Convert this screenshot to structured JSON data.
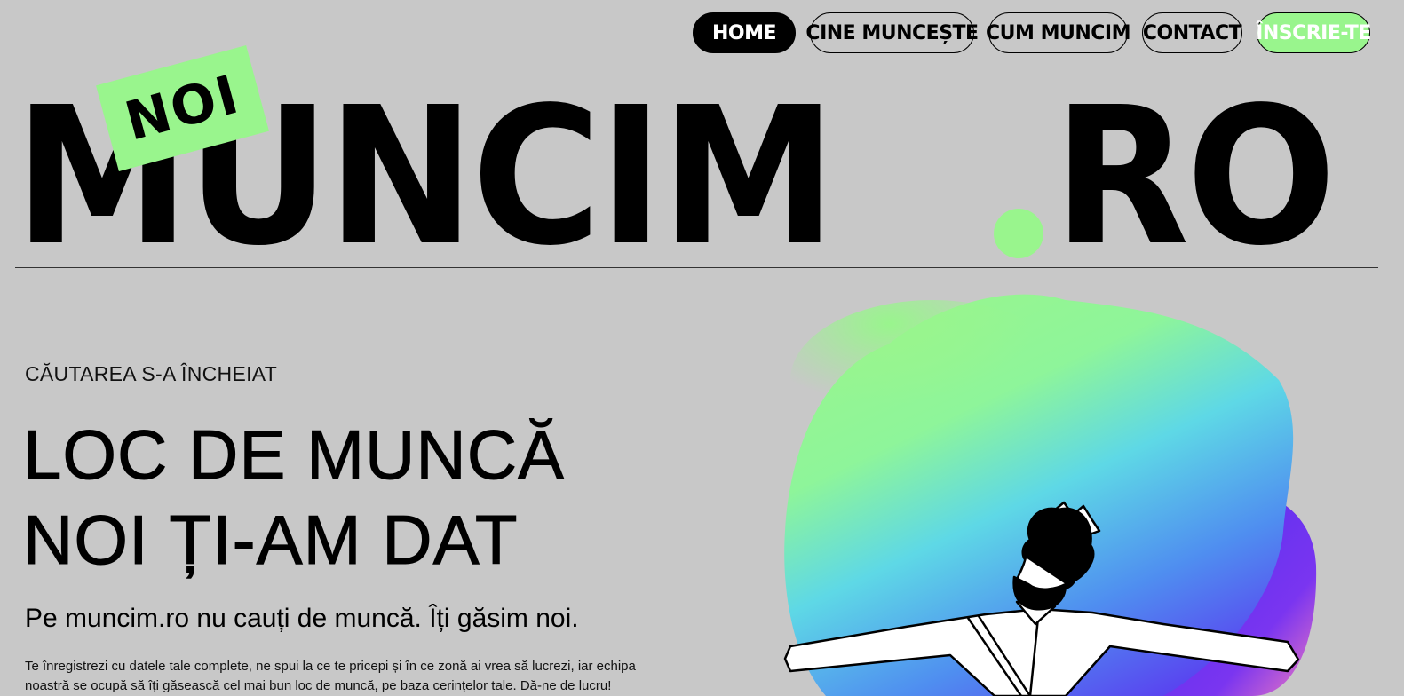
{
  "nav": {
    "items": [
      {
        "label": "HOME"
      },
      {
        "label": "CINE MUNCEȘTE"
      },
      {
        "label": "CUM MUNCIM"
      },
      {
        "label": "CONTACT"
      },
      {
        "label": "ÎNSCRIE-TE"
      }
    ]
  },
  "logo": {
    "badge": "NOI",
    "word": "MUNCIM",
    "suffix": "RO"
  },
  "hero": {
    "eyebrow": "CĂUTAREA S-A ÎNCHEIAT",
    "headline_line1": "LOC DE MUNCĂ",
    "headline_line2": "NOI ȚI-AM DAT",
    "subtitle": "Pe muncim.ro nu cauți de muncă. Îți găsim noi.",
    "body": "Te înregistrezi cu datele tale complete, ne spui la ce te pricepi și în ce zonă ai vrea să lucrezi, iar echipa noastră se ocupă să îți găsească cel mai bun loc de muncă, pe baza cerințelor tale. Dă-ne de lucru!"
  },
  "colors": {
    "background": "#c8c8c8",
    "accent": "#99f58d",
    "text": "#000000"
  }
}
